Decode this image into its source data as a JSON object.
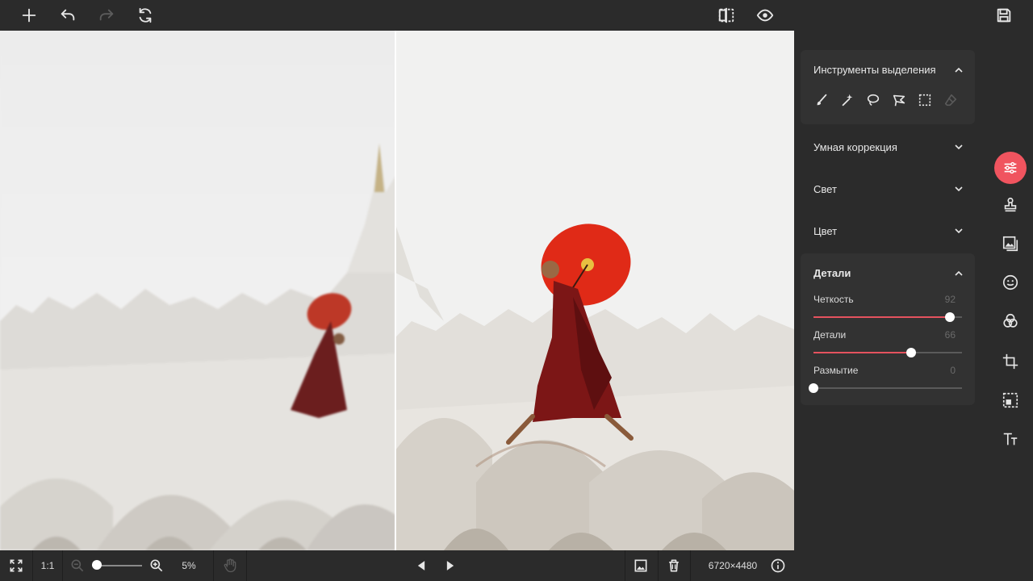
{
  "toolbar": {
    "add": "plus-icon",
    "undo": "undo-icon",
    "redo": "redo-icon",
    "reset": "reset-icon",
    "compare": "compare-icon",
    "preview": "eye-icon",
    "save": "save-icon"
  },
  "panel": {
    "selection_tools": {
      "title": "Инструменты выделения",
      "tools": [
        "brush-icon",
        "magic-wand-icon",
        "lasso-icon",
        "polygon-lasso-icon",
        "rect-select-icon",
        "eraser-icon"
      ]
    },
    "smart_correction": {
      "title": "Умная коррекция"
    },
    "light": {
      "title": "Свет"
    },
    "color": {
      "title": "Цвет"
    },
    "details": {
      "title": "Детали",
      "sliders": [
        {
          "label": "Четкость",
          "value": "92",
          "level": 0.92
        },
        {
          "label": "Детали",
          "value": "66",
          "level": 0.66
        },
        {
          "label": "Размытие",
          "value": "0",
          "level": 0
        }
      ]
    }
  },
  "rail": [
    "adjust-icon",
    "stamp-icon",
    "image-icon",
    "face-icon",
    "color-circles-icon",
    "crop-icon",
    "transform-icon",
    "text-icon"
  ],
  "bottom": {
    "fit": "fit-screen-icon",
    "one_to_one": "1:1",
    "zoom_level": "5%",
    "zoom_fraction": 0.05,
    "dimensions": "6720×4480"
  },
  "colors": {
    "accent": "#f0545f",
    "panel_bg": "#2b2b2b",
    "section_bg": "#323232",
    "slider_fill": "#e5525e"
  }
}
